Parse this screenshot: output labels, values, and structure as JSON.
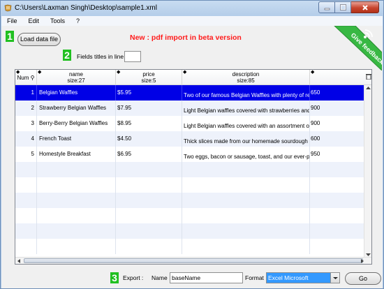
{
  "window": {
    "title": "C:\\Users\\Laxman Singh\\Desktop\\sample1.xml"
  },
  "menu": [
    "File",
    "Edit",
    "Tools",
    "?"
  ],
  "steps": [
    "1",
    "2",
    "3"
  ],
  "load_button": "Load data file",
  "notice": "New : pdf import in beta version",
  "fields_titles_label": "Fields titles in line :",
  "fields_titles_value": "",
  "feedback": {
    "label": "Give feedback",
    "icon": "rss-icon"
  },
  "grid": {
    "columns": [
      {
        "title": "Num",
        "sub": ""
      },
      {
        "title": "name",
        "sub": "size:27"
      },
      {
        "title": "price",
        "sub": "size:5"
      },
      {
        "title": "description",
        "sub": "size:85"
      },
      {
        "title": "",
        "sub": ""
      }
    ],
    "rows": [
      {
        "num": "1",
        "name": "Belgian Waffles",
        "price": "$5.95",
        "description": "Two of our famous Belgian Waffles with plenty of real m",
        "calories": "650",
        "selected": true
      },
      {
        "num": "2",
        "name": "Strawberry Belgian Waffles",
        "price": "$7.95",
        "description": "Light Belgian waffles covered with strawberries and whip",
        "calories": "900",
        "selected": false
      },
      {
        "num": "3",
        "name": "Berry-Berry Belgian Waffles",
        "price": "$8.95",
        "description": "Light Belgian waffles covered with an assortment of fres",
        "calories": "900",
        "selected": false
      },
      {
        "num": "4",
        "name": "French Toast",
        "price": "$4.50",
        "description": "Thick slices made from our homemade sourdough bread",
        "calories": "600",
        "selected": false
      },
      {
        "num": "5",
        "name": "Homestyle Breakfast",
        "price": "$6.95",
        "description": "Two eggs, bacon or sausage, toast, and our ever-popul",
        "calories": "950",
        "selected": false
      }
    ]
  },
  "export": {
    "label": "Export :",
    "name_label": "Name",
    "name_value": "baseName",
    "format_label": "Format",
    "format_value": "Excel Microsoft",
    "go_label": "Go"
  },
  "colors": {
    "accent": "#21c021",
    "notice": "#ff1b1b",
    "selection": "#0000e6"
  }
}
